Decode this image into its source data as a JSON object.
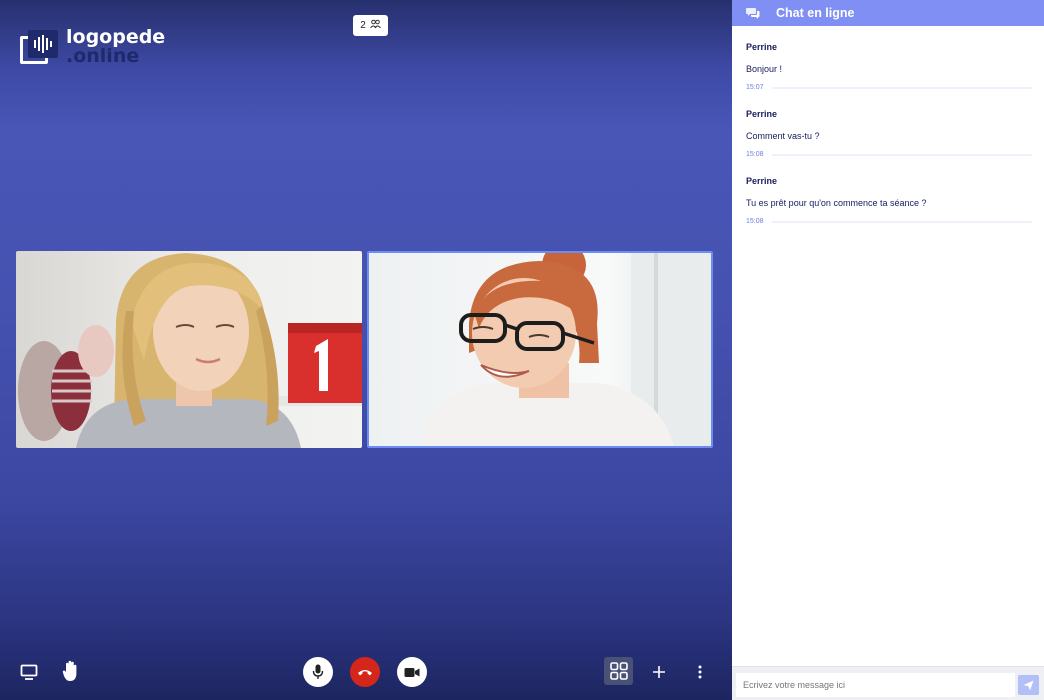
{
  "app": {
    "logo_line1": "logopede",
    "logo_line2": ".online",
    "participants_count": "2"
  },
  "videos": [
    {
      "name": "video-participant-1"
    },
    {
      "name": "video-participant-2",
      "active": true
    }
  ],
  "toolbar": {
    "left": [
      {
        "icon": "screen-share-icon"
      },
      {
        "icon": "raise-hand-icon"
      }
    ],
    "center": [
      {
        "icon": "microphone-icon",
        "color": "#ffffff"
      },
      {
        "icon": "hang-up-icon",
        "color": "#d5261c"
      },
      {
        "icon": "camera-icon",
        "color": "#ffffff"
      }
    ],
    "right": [
      {
        "icon": "grid-view-icon"
      },
      {
        "icon": "plus-icon"
      },
      {
        "icon": "more-vertical-icon"
      }
    ]
  },
  "chat": {
    "title": "Chat en ligne",
    "messages": [
      {
        "author": "Perrine",
        "text": "Bonjour !",
        "time": "15:07"
      },
      {
        "author": "Perrine",
        "text": "Comment vas-tu ?",
        "time": "15:08"
      },
      {
        "author": "Perrine",
        "text": "Tu es prêt pour qu'on commence ta séance ?",
        "time": "15:08"
      }
    ],
    "input_placeholder": "Ecrivez votre message ici"
  },
  "colors": {
    "accent": "#7f8ff4",
    "navy": "#1b2160",
    "hangup": "#d5261c"
  }
}
